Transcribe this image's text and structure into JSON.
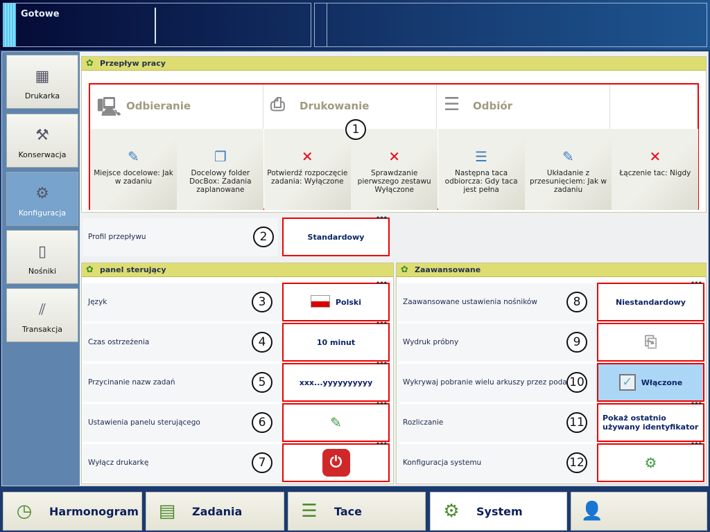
{
  "status": {
    "text": "Gotowe"
  },
  "sidebar": {
    "items": [
      {
        "label": "Drukarka",
        "icon": "printer-icon",
        "glyph": "▦"
      },
      {
        "label": "Konserwacja",
        "icon": "maintenance-icon",
        "glyph": "⚒"
      },
      {
        "label": "Konfiguracja",
        "icon": "configuration-icon",
        "glyph": "⚙",
        "selected": true
      },
      {
        "label": "Nośniki",
        "icon": "media-icon",
        "glyph": "▯"
      },
      {
        "label": "Transakcja",
        "icon": "transaction-icon",
        "glyph": "⫽"
      }
    ]
  },
  "workflow": {
    "title": "Przepływ pracy",
    "badge": "1",
    "phases": [
      {
        "label": "Odbieranie",
        "glyph": "🖳"
      },
      {
        "label": "Drukowanie",
        "glyph": "⎙"
      },
      {
        "label": "Odbiór",
        "glyph": "☰"
      }
    ],
    "tiles": [
      {
        "label": "Miejsce docelowe: Jak w zadaniu",
        "glyph": "✎",
        "off": false
      },
      {
        "label": "Docelowy folder DocBox: Zadania zaplanowane",
        "glyph": "❐",
        "off": false
      },
      {
        "label": "Potwierdź rozpoczęcie zadania: Wyłączone",
        "glyph": "✕",
        "off": true
      },
      {
        "label": "Sprawdzanie pierwszego zestawu Wyłączone",
        "glyph": "✕",
        "off": true
      },
      {
        "label": "Następna taca odbiorcza: Gdy taca jest pełna",
        "glyph": "☰",
        "off": false
      },
      {
        "label": "Układanie z przesunięciem: Jak w zadaniu",
        "glyph": "✎",
        "off": false
      },
      {
        "label": "Łączenie tac: Nigdy",
        "glyph": "✕",
        "off": true
      }
    ]
  },
  "profile": {
    "label": "Profil przepływu",
    "value": "Standardowy",
    "badge": "2"
  },
  "control_panel": {
    "title": "panel sterujący",
    "rows": [
      {
        "label": "Język",
        "value": "Polski",
        "badge": "3",
        "icon": "flag-pl-icon"
      },
      {
        "label": "Czas ostrzeżenia",
        "value": "10 minut",
        "badge": "4"
      },
      {
        "label": "Przycinanie nazw zadań",
        "value": "xxx...yyyyyyyyyy",
        "badge": "5"
      },
      {
        "label": "Ustawienia panelu sterującego",
        "value": "",
        "badge": "6",
        "icon": "edit-panel-icon"
      },
      {
        "label": "Wyłącz drukarkę",
        "value": "",
        "badge": "7",
        "icon": "power-icon"
      }
    ]
  },
  "advanced": {
    "title": "Zaawansowane",
    "rows": [
      {
        "label": "Zaawansowane ustawienia nośników",
        "value": "Niestandardowy",
        "badge": "8"
      },
      {
        "label": "Wydruk próbny",
        "value": "",
        "badge": "9",
        "icon": "sample-print-icon"
      },
      {
        "label": "Wykrywaj pobranie wielu arkuszy przez podajnik",
        "value": "Włączone",
        "badge": "10",
        "icon": "checkbox-icon"
      },
      {
        "label": "Rozliczanie",
        "value": "Pokaż ostatnio używany identyfikator",
        "badge": "11"
      },
      {
        "label": "Konfiguracja systemu",
        "value": "",
        "badge": "12",
        "icon": "gear-icon"
      }
    ]
  },
  "bottom_tabs": [
    {
      "label": "Harmonogram",
      "icon": "clock-icon",
      "glyph": "◷"
    },
    {
      "label": "Zadania",
      "icon": "jobs-icon",
      "glyph": "▤"
    },
    {
      "label": "Tace",
      "icon": "trays-icon",
      "glyph": "☰"
    },
    {
      "label": "System",
      "icon": "system-gears-icon",
      "glyph": "⚙",
      "selected": true
    },
    {
      "label": "",
      "icon": "user-key-icon",
      "glyph": "👤"
    }
  ],
  "colors": {
    "highlight": "#e00000",
    "section_header": "#dedd72",
    "selected_blue": "#acd6f6"
  }
}
